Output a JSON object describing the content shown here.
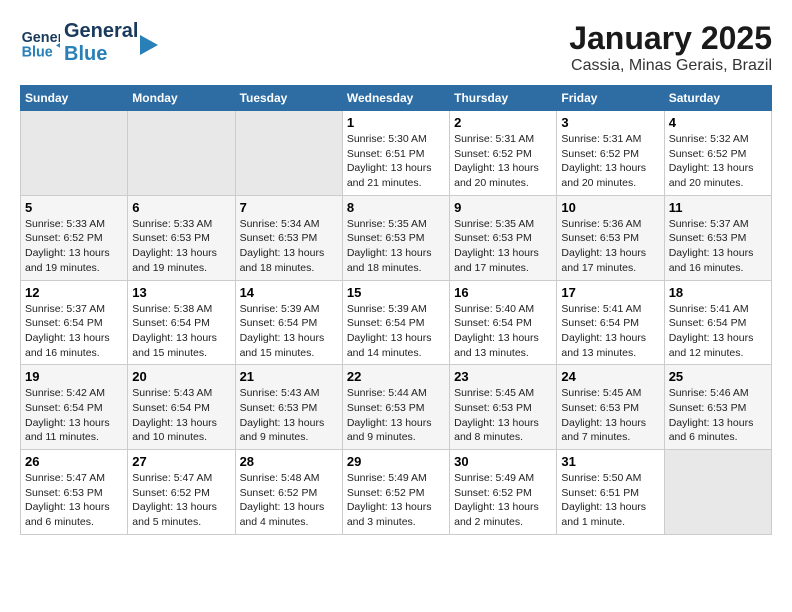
{
  "header": {
    "logo_line1": "General",
    "logo_line2": "Blue",
    "title": "January 2025",
    "subtitle": "Cassia, Minas Gerais, Brazil"
  },
  "calendar": {
    "weekdays": [
      "Sunday",
      "Monday",
      "Tuesday",
      "Wednesday",
      "Thursday",
      "Friday",
      "Saturday"
    ],
    "weeks": [
      [
        {
          "day": "",
          "sunrise": "",
          "sunset": "",
          "daylight": "",
          "empty": true
        },
        {
          "day": "",
          "sunrise": "",
          "sunset": "",
          "daylight": "",
          "empty": true
        },
        {
          "day": "",
          "sunrise": "",
          "sunset": "",
          "daylight": "",
          "empty": true
        },
        {
          "day": "1",
          "sunrise": "Sunrise: 5:30 AM",
          "sunset": "Sunset: 6:51 PM",
          "daylight": "Daylight: 13 hours and 21 minutes.",
          "empty": false
        },
        {
          "day": "2",
          "sunrise": "Sunrise: 5:31 AM",
          "sunset": "Sunset: 6:52 PM",
          "daylight": "Daylight: 13 hours and 20 minutes.",
          "empty": false
        },
        {
          "day": "3",
          "sunrise": "Sunrise: 5:31 AM",
          "sunset": "Sunset: 6:52 PM",
          "daylight": "Daylight: 13 hours and 20 minutes.",
          "empty": false
        },
        {
          "day": "4",
          "sunrise": "Sunrise: 5:32 AM",
          "sunset": "Sunset: 6:52 PM",
          "daylight": "Daylight: 13 hours and 20 minutes.",
          "empty": false
        }
      ],
      [
        {
          "day": "5",
          "sunrise": "Sunrise: 5:33 AM",
          "sunset": "Sunset: 6:52 PM",
          "daylight": "Daylight: 13 hours and 19 minutes.",
          "empty": false
        },
        {
          "day": "6",
          "sunrise": "Sunrise: 5:33 AM",
          "sunset": "Sunset: 6:53 PM",
          "daylight": "Daylight: 13 hours and 19 minutes.",
          "empty": false
        },
        {
          "day": "7",
          "sunrise": "Sunrise: 5:34 AM",
          "sunset": "Sunset: 6:53 PM",
          "daylight": "Daylight: 13 hours and 18 minutes.",
          "empty": false
        },
        {
          "day": "8",
          "sunrise": "Sunrise: 5:35 AM",
          "sunset": "Sunset: 6:53 PM",
          "daylight": "Daylight: 13 hours and 18 minutes.",
          "empty": false
        },
        {
          "day": "9",
          "sunrise": "Sunrise: 5:35 AM",
          "sunset": "Sunset: 6:53 PM",
          "daylight": "Daylight: 13 hours and 17 minutes.",
          "empty": false
        },
        {
          "day": "10",
          "sunrise": "Sunrise: 5:36 AM",
          "sunset": "Sunset: 6:53 PM",
          "daylight": "Daylight: 13 hours and 17 minutes.",
          "empty": false
        },
        {
          "day": "11",
          "sunrise": "Sunrise: 5:37 AM",
          "sunset": "Sunset: 6:53 PM",
          "daylight": "Daylight: 13 hours and 16 minutes.",
          "empty": false
        }
      ],
      [
        {
          "day": "12",
          "sunrise": "Sunrise: 5:37 AM",
          "sunset": "Sunset: 6:54 PM",
          "daylight": "Daylight: 13 hours and 16 minutes.",
          "empty": false
        },
        {
          "day": "13",
          "sunrise": "Sunrise: 5:38 AM",
          "sunset": "Sunset: 6:54 PM",
          "daylight": "Daylight: 13 hours and 15 minutes.",
          "empty": false
        },
        {
          "day": "14",
          "sunrise": "Sunrise: 5:39 AM",
          "sunset": "Sunset: 6:54 PM",
          "daylight": "Daylight: 13 hours and 15 minutes.",
          "empty": false
        },
        {
          "day": "15",
          "sunrise": "Sunrise: 5:39 AM",
          "sunset": "Sunset: 6:54 PM",
          "daylight": "Daylight: 13 hours and 14 minutes.",
          "empty": false
        },
        {
          "day": "16",
          "sunrise": "Sunrise: 5:40 AM",
          "sunset": "Sunset: 6:54 PM",
          "daylight": "Daylight: 13 hours and 13 minutes.",
          "empty": false
        },
        {
          "day": "17",
          "sunrise": "Sunrise: 5:41 AM",
          "sunset": "Sunset: 6:54 PM",
          "daylight": "Daylight: 13 hours and 13 minutes.",
          "empty": false
        },
        {
          "day": "18",
          "sunrise": "Sunrise: 5:41 AM",
          "sunset": "Sunset: 6:54 PM",
          "daylight": "Daylight: 13 hours and 12 minutes.",
          "empty": false
        }
      ],
      [
        {
          "day": "19",
          "sunrise": "Sunrise: 5:42 AM",
          "sunset": "Sunset: 6:54 PM",
          "daylight": "Daylight: 13 hours and 11 minutes.",
          "empty": false
        },
        {
          "day": "20",
          "sunrise": "Sunrise: 5:43 AM",
          "sunset": "Sunset: 6:54 PM",
          "daylight": "Daylight: 13 hours and 10 minutes.",
          "empty": false
        },
        {
          "day": "21",
          "sunrise": "Sunrise: 5:43 AM",
          "sunset": "Sunset: 6:53 PM",
          "daylight": "Daylight: 13 hours and 9 minutes.",
          "empty": false
        },
        {
          "day": "22",
          "sunrise": "Sunrise: 5:44 AM",
          "sunset": "Sunset: 6:53 PM",
          "daylight": "Daylight: 13 hours and 9 minutes.",
          "empty": false
        },
        {
          "day": "23",
          "sunrise": "Sunrise: 5:45 AM",
          "sunset": "Sunset: 6:53 PM",
          "daylight": "Daylight: 13 hours and 8 minutes.",
          "empty": false
        },
        {
          "day": "24",
          "sunrise": "Sunrise: 5:45 AM",
          "sunset": "Sunset: 6:53 PM",
          "daylight": "Daylight: 13 hours and 7 minutes.",
          "empty": false
        },
        {
          "day": "25",
          "sunrise": "Sunrise: 5:46 AM",
          "sunset": "Sunset: 6:53 PM",
          "daylight": "Daylight: 13 hours and 6 minutes.",
          "empty": false
        }
      ],
      [
        {
          "day": "26",
          "sunrise": "Sunrise: 5:47 AM",
          "sunset": "Sunset: 6:53 PM",
          "daylight": "Daylight: 13 hours and 6 minutes.",
          "empty": false
        },
        {
          "day": "27",
          "sunrise": "Sunrise: 5:47 AM",
          "sunset": "Sunset: 6:52 PM",
          "daylight": "Daylight: 13 hours and 5 minutes.",
          "empty": false
        },
        {
          "day": "28",
          "sunrise": "Sunrise: 5:48 AM",
          "sunset": "Sunset: 6:52 PM",
          "daylight": "Daylight: 13 hours and 4 minutes.",
          "empty": false
        },
        {
          "day": "29",
          "sunrise": "Sunrise: 5:49 AM",
          "sunset": "Sunset: 6:52 PM",
          "daylight": "Daylight: 13 hours and 3 minutes.",
          "empty": false
        },
        {
          "day": "30",
          "sunrise": "Sunrise: 5:49 AM",
          "sunset": "Sunset: 6:52 PM",
          "daylight": "Daylight: 13 hours and 2 minutes.",
          "empty": false
        },
        {
          "day": "31",
          "sunrise": "Sunrise: 5:50 AM",
          "sunset": "Sunset: 6:51 PM",
          "daylight": "Daylight: 13 hours and 1 minute.",
          "empty": false
        },
        {
          "day": "",
          "sunrise": "",
          "sunset": "",
          "daylight": "",
          "empty": true
        }
      ]
    ]
  }
}
